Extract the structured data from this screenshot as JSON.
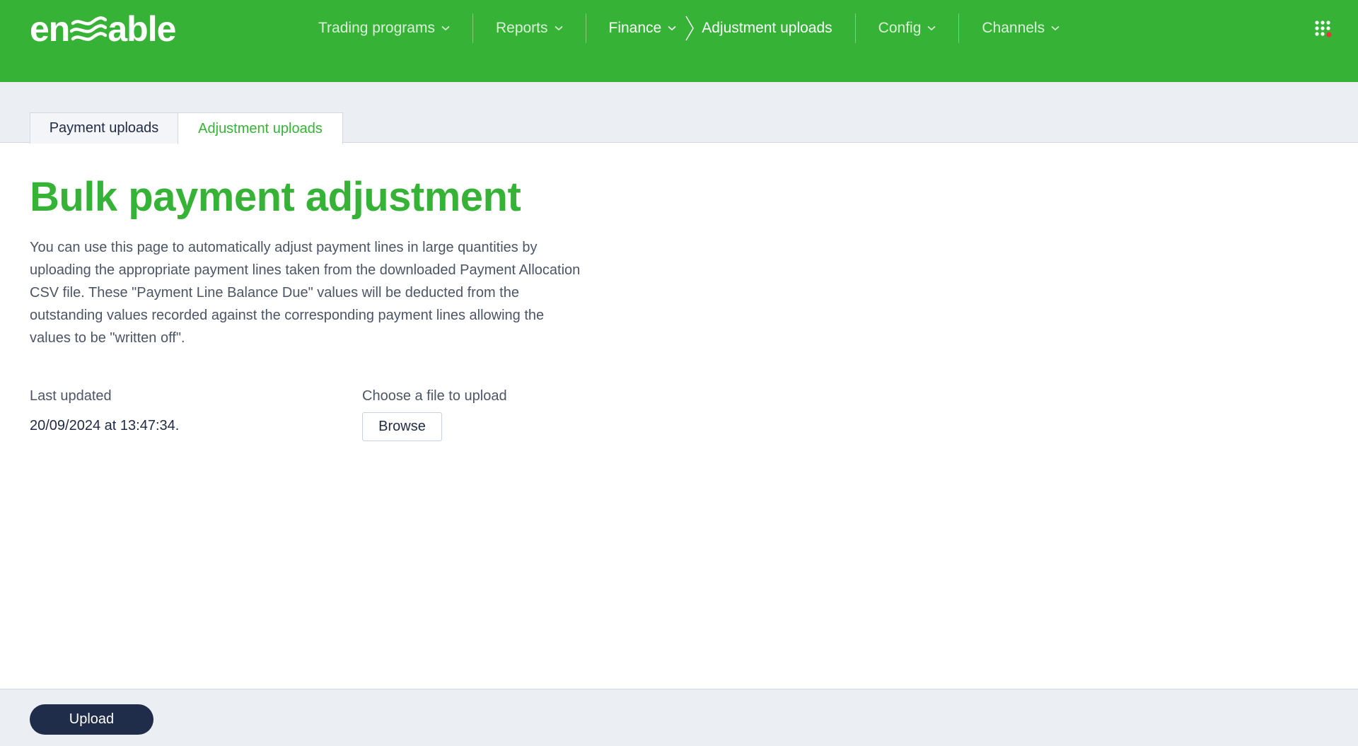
{
  "brand": {
    "logo_left": "en",
    "logo_right": "able",
    "header_color": "#36b336",
    "accent_color": "#36b336",
    "primary_dark": "#1f2d4b",
    "notification_dot_color": "#e53935"
  },
  "nav": {
    "items": [
      {
        "label": "Trading programs",
        "icon": "chevron-down-icon"
      },
      {
        "label": "Reports",
        "icon": "chevron-down-icon"
      },
      {
        "label": "Finance",
        "icon": "chevron-down-icon"
      },
      {
        "label": "Config",
        "icon": "chevron-down-icon"
      },
      {
        "label": "Channels",
        "icon": "chevron-down-icon"
      }
    ],
    "breadcrumb_current": "Adjustment uploads",
    "apps_icon": "apps-grid-icon"
  },
  "tabs": [
    {
      "label": "Payment uploads",
      "active": false
    },
    {
      "label": "Adjustment uploads",
      "active": true
    }
  ],
  "main": {
    "title": "Bulk payment adjustment",
    "description": "You can use this page to automatically adjust payment lines in large quantities by uploading the appropriate payment lines taken from the downloaded Payment Allocation CSV file. These \"Payment Line Balance Due\" values will be deducted from the outstanding values recorded against the corresponding payment lines allowing the values to be \"written off\".",
    "last_updated_label": "Last updated",
    "last_updated_value": "20/09/2024 at 13:47:34.",
    "choose_file_label": "Choose a file to upload",
    "browse_label": "Browse"
  },
  "footer": {
    "upload_label": "Upload"
  }
}
